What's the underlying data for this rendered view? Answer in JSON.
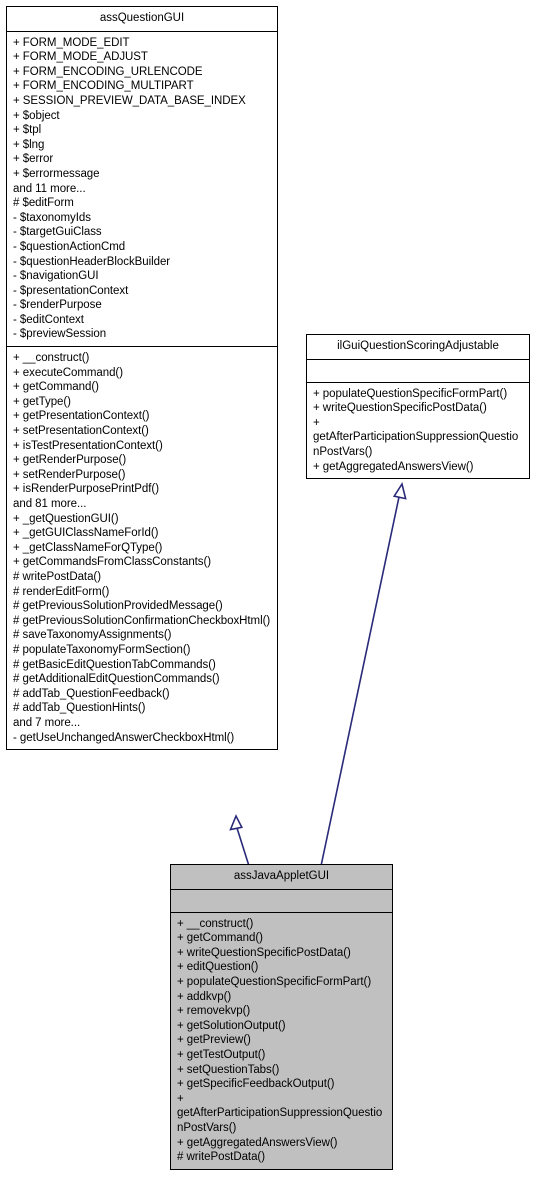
{
  "diagram": {
    "kind": "uml-class-diagram",
    "edge_color": "#2a2a7a",
    "filled_fill_color": "#c0c0c0",
    "border_color": "#000000"
  },
  "classes": {
    "base": {
      "name": "assQuestionGUI",
      "attributes": [
        "+ FORM_MODE_EDIT",
        "+ FORM_MODE_ADJUST",
        "+ FORM_ENCODING_URLENCODE",
        "+ FORM_ENCODING_MULTIPART",
        "+ SESSION_PREVIEW_DATA_BASE_INDEX",
        "+ $object",
        "+ $tpl",
        "+ $lng",
        "+ $error",
        "+ $errormessage",
        "and 11 more...",
        "# $editForm",
        "- $taxonomyIds",
        "- $targetGuiClass",
        "- $questionActionCmd",
        "- $questionHeaderBlockBuilder",
        "- $navigationGUI",
        "- $presentationContext",
        "- $renderPurpose",
        "- $editContext",
        "- $previewSession"
      ],
      "methods": [
        "+ __construct()",
        "+ executeCommand()",
        "+ getCommand()",
        "+ getType()",
        "+ getPresentationContext()",
        "+ setPresentationContext()",
        "+ isTestPresentationContext()",
        "+ getRenderPurpose()",
        "+ setRenderPurpose()",
        "+ isRenderPurposePrintPdf()",
        "and 81 more...",
        "+ _getQuestionGUI()",
        "+ _getGUIClassNameForId()",
        "+ _getClassNameForQType()",
        "+ getCommandsFromClassConstants()",
        "# writePostData()",
        "# renderEditForm()",
        "# getPreviousSolutionProvidedMessage()",
        "# getPreviousSolutionConfirmationCheckboxHtml()",
        "# saveTaxonomyAssignments()",
        "# populateTaxonomyFormSection()",
        "# getBasicEditQuestionTabCommands()",
        "# getAdditionalEditQuestionCommands()",
        "# addTab_QuestionFeedback()",
        "# addTab_QuestionHints()",
        "and 7 more...",
        "- getUseUnchangedAnswerCheckboxHtml()"
      ]
    },
    "interface": {
      "name": "ilGuiQuestionScoringAdjustable",
      "attributes": [],
      "methods": [
        "+ populateQuestionSpecificFormPart()",
        "+ writeQuestionSpecificPostData()",
        "+ getAfterParticipationSuppressionQuestionPostVars()",
        "+ getAggregatedAnswersView()"
      ]
    },
    "derived": {
      "name": "assJavaAppletGUI",
      "attributes": [],
      "methods": [
        "+ __construct()",
        "+ getCommand()",
        "+ writeQuestionSpecificPostData()",
        "+ editQuestion()",
        "+ populateQuestionSpecificFormPart()",
        "+ addkvp()",
        "+ removekvp()",
        "+ getSolutionOutput()",
        "+ getPreview()",
        "+ getTestOutput()",
        "+ setQuestionTabs()",
        "+ getSpecificFeedbackOutput()",
        "+ getAfterParticipationSuppressionQuestionPostVars()",
        "+ getAggregatedAnswersView()",
        "# writePostData()"
      ]
    }
  },
  "relations": [
    {
      "from": "derived",
      "to": "base",
      "type": "inheritance"
    },
    {
      "from": "derived",
      "to": "interface",
      "type": "realization"
    }
  ]
}
